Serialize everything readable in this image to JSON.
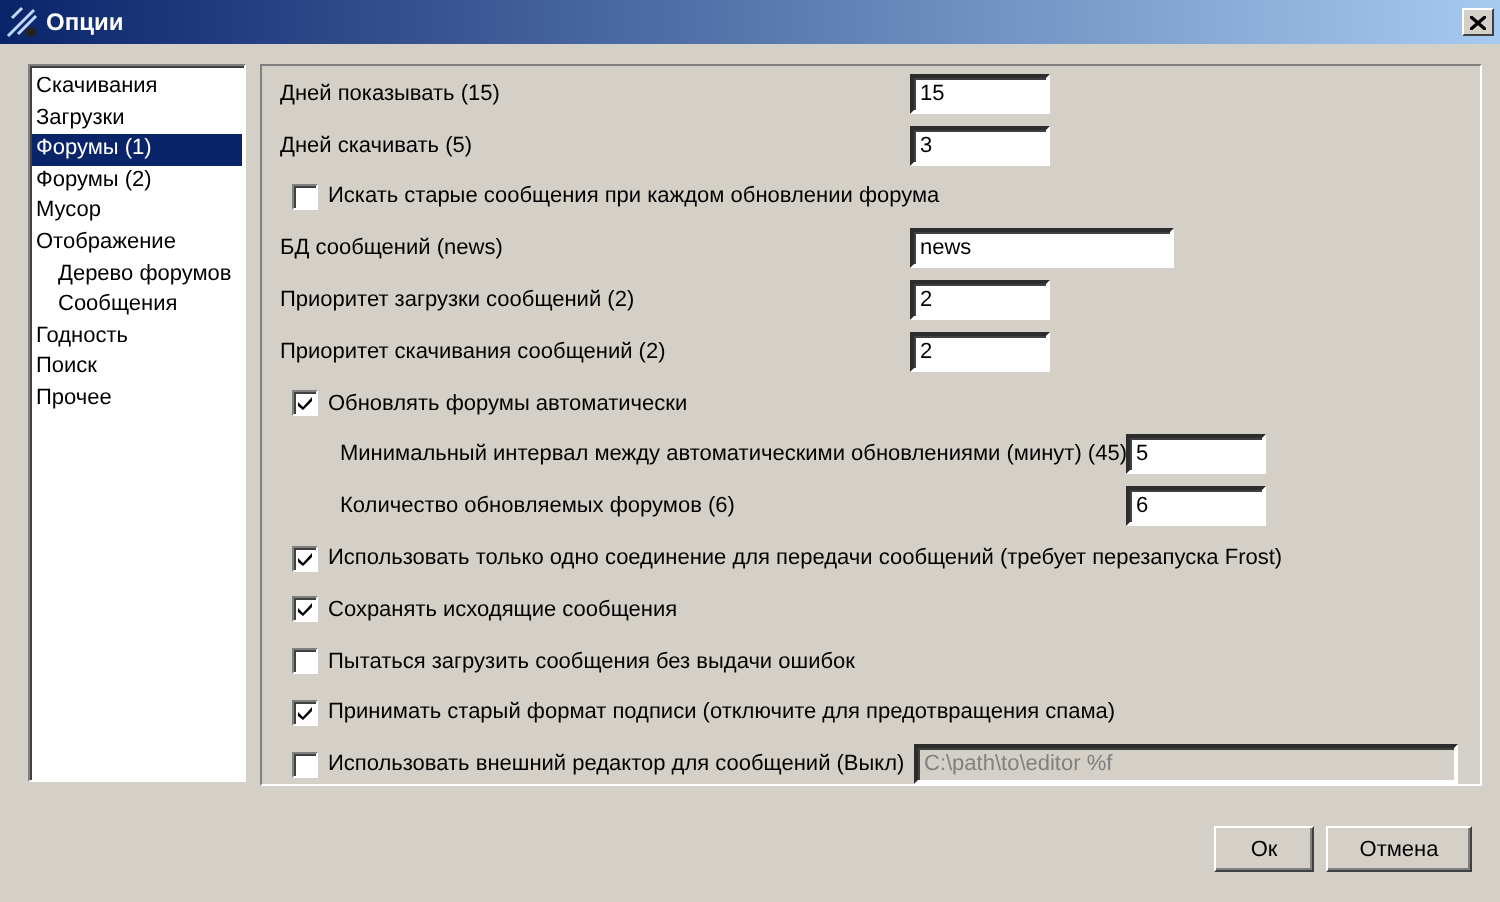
{
  "window": {
    "title": "Опции"
  },
  "sidebar": {
    "items": [
      {
        "label": "Скачивания",
        "selected": false
      },
      {
        "label": "Загрузки",
        "selected": false
      },
      {
        "label": "Форумы (1)",
        "selected": true
      },
      {
        "label": "Форумы (2)",
        "selected": false
      },
      {
        "label": "Мусор",
        "selected": false
      },
      {
        "label": "Отображение",
        "selected": false,
        "children": [
          {
            "label": "Дерево форумов",
            "selected": false
          },
          {
            "label": "Сообщения",
            "selected": false
          }
        ]
      },
      {
        "label": "Годность",
        "selected": false
      },
      {
        "label": "Поиск",
        "selected": false
      },
      {
        "label": "Прочее",
        "selected": false
      }
    ]
  },
  "settings": [
    {
      "kind": "short_field",
      "label": "Дней показывать (15)",
      "value": "15"
    },
    {
      "kind": "short_field",
      "label": "Дней скачивать (5)",
      "value": "3"
    },
    {
      "kind": "check",
      "label": "Искать старые сообщения при каждом обновлении форума",
      "checked": false
    },
    {
      "kind": "wide_field",
      "label": "БД сообщений (news)",
      "value": "news"
    },
    {
      "kind": "short_field",
      "label": "Приоритет загрузки сообщений (2)",
      "value": "2"
    },
    {
      "kind": "short_field",
      "label": "Приоритет скачивания сообщений (2)",
      "value": "2"
    },
    {
      "kind": "check",
      "label": "Обновлять форумы автоматически",
      "checked": true
    },
    {
      "kind": "sub_field",
      "label": "Минимальный интервал между автоматическими обновлениями (минут) (45)",
      "value": "5"
    },
    {
      "kind": "sub_field",
      "label": "Количество обновляемых форумов (6)",
      "value": "6"
    },
    {
      "kind": "check",
      "label": "Использовать только одно соединение для передачи сообщений (требует перезапуска Frost)",
      "checked": true
    },
    {
      "kind": "check",
      "label": "Сохранять исходящие сообщения",
      "checked": true
    },
    {
      "kind": "check",
      "label": "Пытаться загрузить сообщения без выдачи ошибок",
      "checked": false
    },
    {
      "kind": "check",
      "label": "Принимать старый формат подписи (отключите для предотвращения спама)",
      "checked": true
    },
    {
      "kind": "check_path",
      "label": "Использовать внешний редактор для сообщений (Выкл)",
      "checked": false,
      "value": "C:\\path\\to\\editor %f",
      "disabled": true
    }
  ],
  "buttons": [
    "Ок",
    "Отмена"
  ]
}
